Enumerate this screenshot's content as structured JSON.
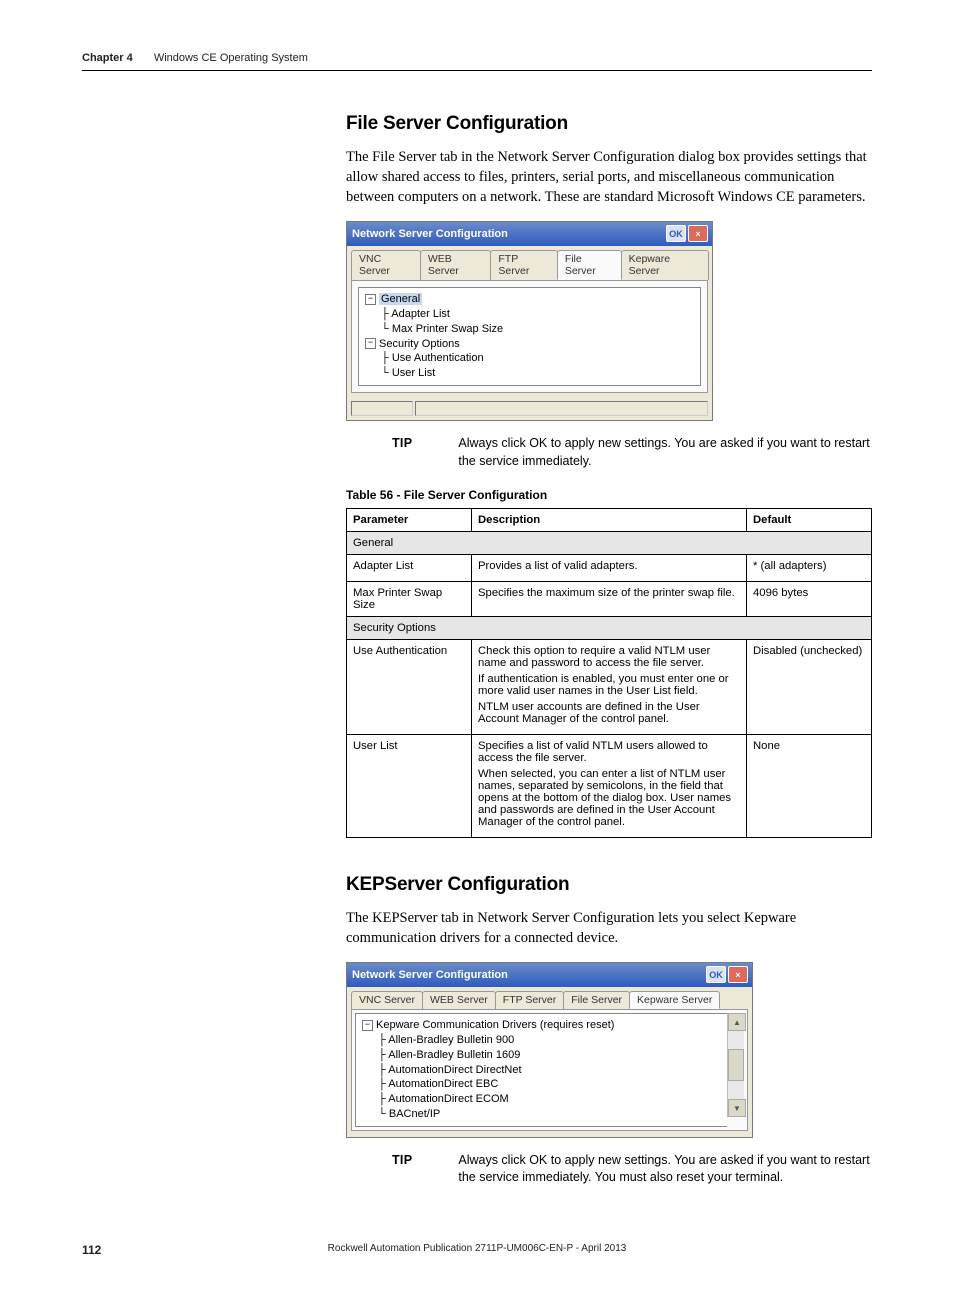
{
  "header": {
    "chapter_label": "Chapter 4",
    "chapter_title": "Windows CE Operating System"
  },
  "file_server": {
    "heading": "File Server Configuration",
    "intro": "The File Server tab in the Network Server Configuration dialog box provides settings that allow shared access to files, printers, serial ports, and miscellaneous communication between computers on a network. These are standard Microsoft Windows CE parameters.",
    "dialog_title": "Network Server Configuration",
    "tabs": [
      "VNC Server",
      "WEB Server",
      "FTP Server",
      "File Server",
      "Kepware Server"
    ],
    "active_tab": "File Server",
    "tree": {
      "root1": "General",
      "root1_children": [
        "Adapter List",
        "Max Printer Swap Size"
      ],
      "root2": "Security Options",
      "root2_children": [
        "Use Authentication",
        "User List"
      ]
    },
    "tip": "Always click OK to apply new settings. You are asked if you want to restart the service immediately.",
    "tip_label": "TIP",
    "table_caption": "Table 56 - File Server Configuration",
    "table": {
      "headers": [
        "Parameter",
        "Description",
        "Default"
      ],
      "section1": "General",
      "rows1": [
        {
          "param": "Adapter List",
          "desc": [
            "Provides a list of valid adapters."
          ],
          "def": "* (all adapters)"
        },
        {
          "param": "Max Printer Swap Size",
          "desc": [
            "Specifies the maximum size of the printer swap file."
          ],
          "def": "4096 bytes"
        }
      ],
      "section2": "Security Options",
      "rows2": [
        {
          "param": "Use Authentication",
          "desc": [
            "Check this option to require a valid NTLM user name and password to access the file server.",
            "If authentication is enabled, you must enter one or more valid user names in the User List field.",
            "NTLM user accounts are defined in the User Account Manager of the control panel."
          ],
          "def": "Disabled (unchecked)"
        },
        {
          "param": "User List",
          "desc": [
            "Specifies a list of valid NTLM users allowed to access the file server.",
            "When selected, you can enter a list of NTLM user names, separated by semicolons, in the field that opens at the bottom of the dialog box. User names and passwords are defined in the User Account Manager of the control panel."
          ],
          "def": "None"
        }
      ]
    }
  },
  "kepserver": {
    "heading": "KEPServer Configuration",
    "intro": "The KEPServer tab in Network Server Configuration lets you select Kepware communication drivers for a connected device.",
    "dialog_title": "Network Server Configuration",
    "tabs": [
      "VNC Server",
      "WEB Server",
      "FTP Server",
      "File Server",
      "Kepware Server"
    ],
    "active_tab": "Kepware Server",
    "tree": {
      "root": "Kepware Communication Drivers (requires reset)",
      "children": [
        "Allen-Bradley Bulletin 900",
        "Allen-Bradley Bulletin 1609",
        "AutomationDirect DirectNet",
        "AutomationDirect EBC",
        "AutomationDirect ECOM",
        "BACnet/IP"
      ]
    },
    "tip_label": "TIP",
    "tip": "Always click OK to apply new settings. You are asked if you want to restart the service immediately. You must also reset your terminal."
  },
  "footer": {
    "page": "112",
    "pub": "Rockwell Automation Publication 2711P-UM006C-EN-P - April 2013"
  }
}
